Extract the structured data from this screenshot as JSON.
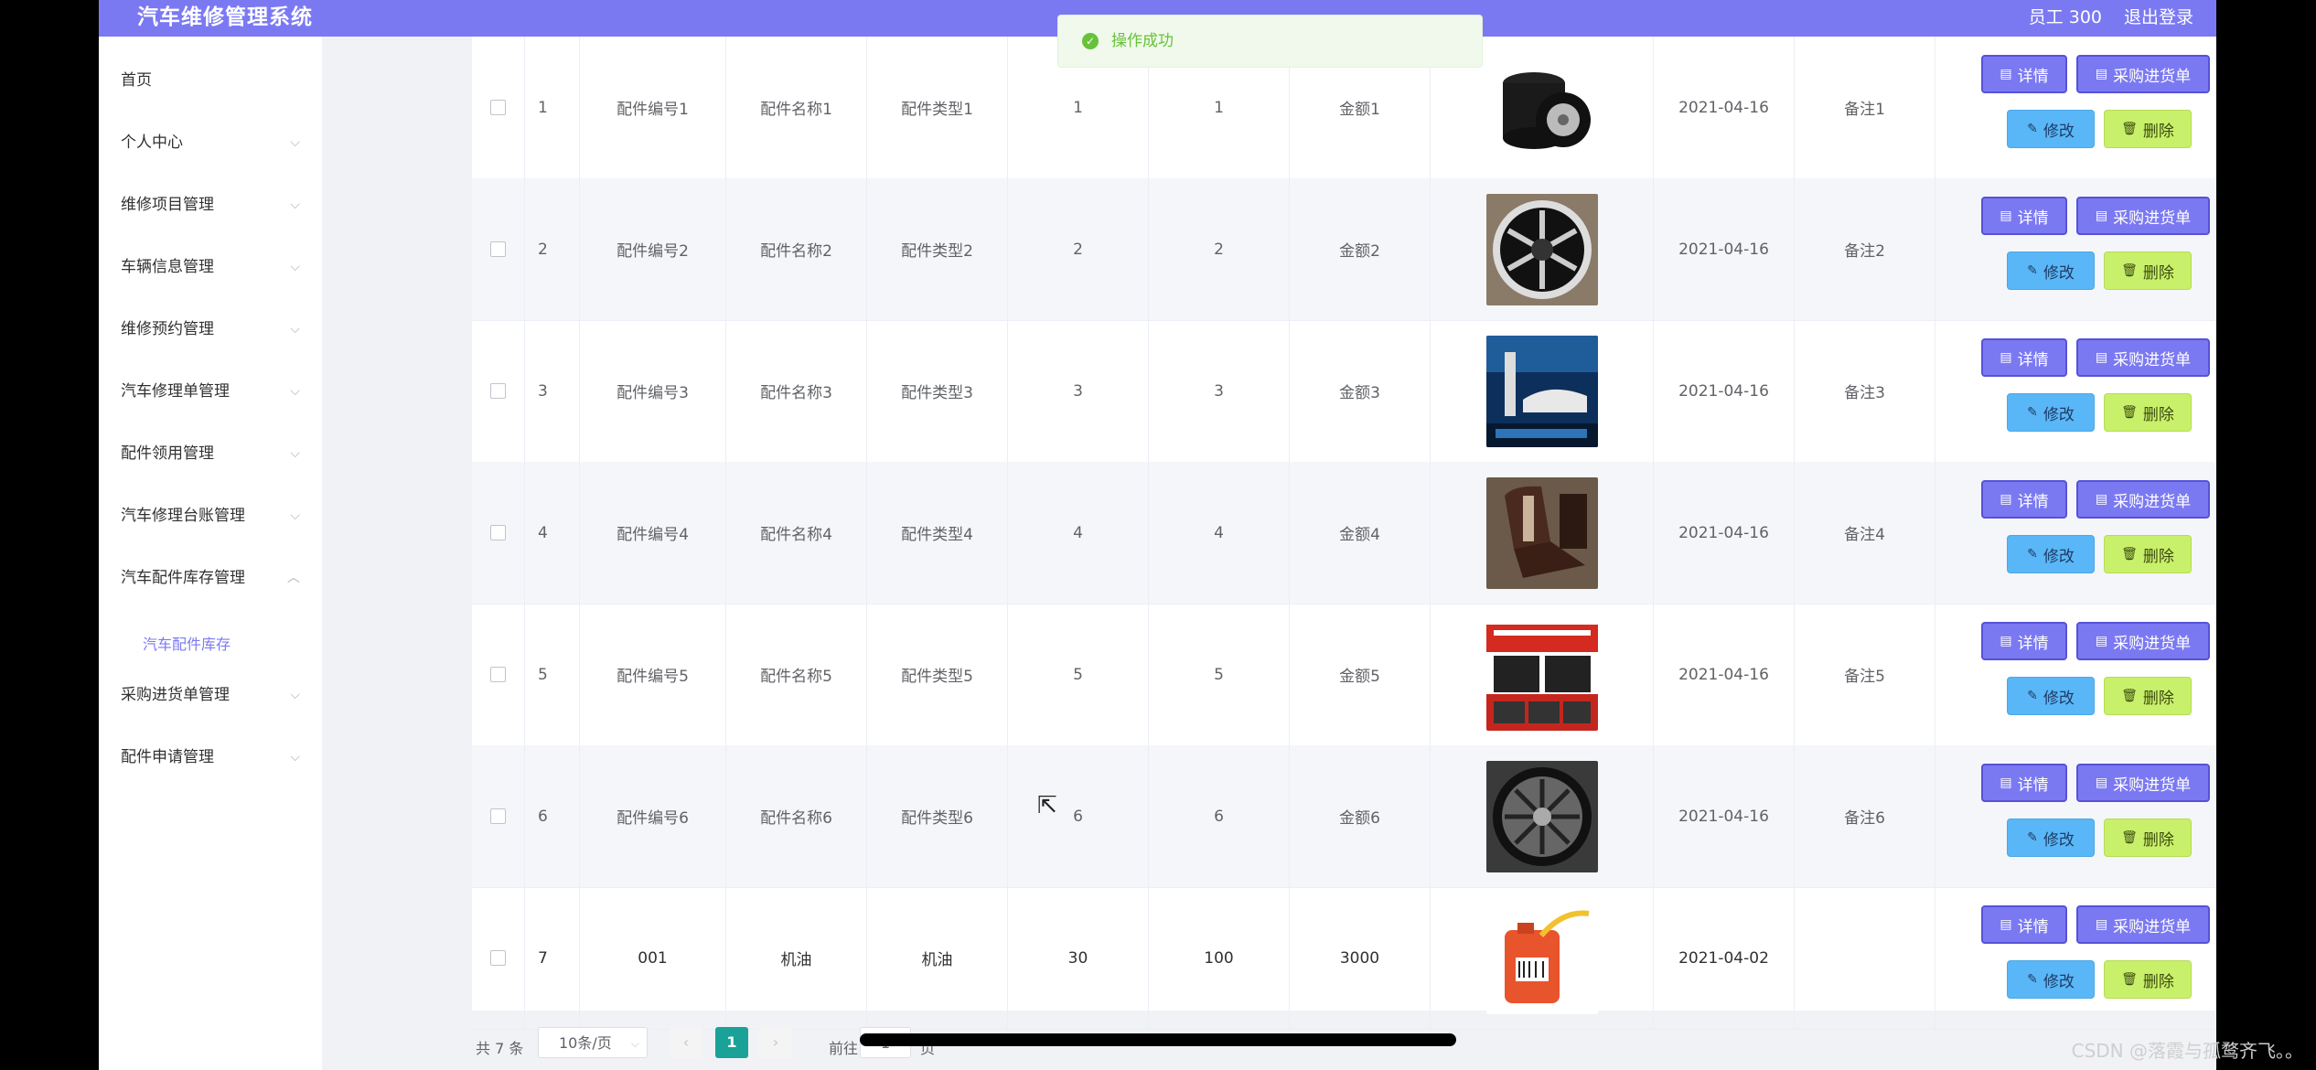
{
  "app": {
    "title": "汽车维修管理系统",
    "user": "员工 300",
    "logout": "退出登录"
  },
  "sidebar": {
    "items": [
      {
        "label": "首页",
        "chevron": ""
      },
      {
        "label": "个人中心",
        "chevron": "⌵"
      },
      {
        "label": "维修项目管理",
        "chevron": "⌵"
      },
      {
        "label": "车辆信息管理",
        "chevron": "⌵"
      },
      {
        "label": "维修预约管理",
        "chevron": "⌵"
      },
      {
        "label": "汽车修理单管理",
        "chevron": "⌵"
      },
      {
        "label": "配件领用管理",
        "chevron": "⌵"
      },
      {
        "label": "汽车修理台账管理",
        "chevron": "⌵"
      },
      {
        "label": "汽车配件库存管理",
        "chevron": "︿"
      },
      {
        "label": "采购进货单管理",
        "chevron": "⌵"
      },
      {
        "label": "配件申请管理",
        "chevron": "⌵"
      }
    ],
    "active_sub": "汽车配件库存"
  },
  "toast": {
    "message": "操作成功"
  },
  "buttons": {
    "detail": "详情",
    "purchase": "采购进货单",
    "edit": "修改",
    "delete": "删除"
  },
  "table": {
    "rows": [
      {
        "index": "1",
        "code": "配件编号1",
        "name": "配件名称1",
        "type": "配件类型1",
        "c1": "1",
        "c2": "1",
        "amount": "金额1",
        "image": "tires",
        "date": "2021-04-16",
        "note": "备注1"
      },
      {
        "index": "2",
        "code": "配件编号2",
        "name": "配件名称2",
        "type": "配件类型2",
        "c1": "2",
        "c2": "2",
        "amount": "金额2",
        "image": "wheel",
        "date": "2021-04-16",
        "note": "备注2"
      },
      {
        "index": "3",
        "code": "配件编号3",
        "name": "配件名称3",
        "type": "配件类型3",
        "c1": "3",
        "c2": "3",
        "amount": "金额3",
        "image": "spark-plug-ad",
        "date": "2021-04-16",
        "note": "备注3"
      },
      {
        "index": "4",
        "code": "配件编号4",
        "name": "配件名称4",
        "type": "配件类型4",
        "c1": "4",
        "c2": "4",
        "amount": "金额4",
        "image": "seat",
        "date": "2021-04-16",
        "note": "备注4"
      },
      {
        "index": "5",
        "code": "配件编号5",
        "name": "配件名称5",
        "type": "配件类型5",
        "c1": "5",
        "c2": "5",
        "amount": "金额5",
        "image": "product-box-ad",
        "date": "2021-04-16",
        "note": "备注5"
      },
      {
        "index": "6",
        "code": "配件编号6",
        "name": "配件名称6",
        "type": "配件类型6",
        "c1": "6",
        "c2": "6",
        "amount": "金额6",
        "image": "rim",
        "date": "2021-04-16",
        "note": "备注6"
      },
      {
        "index": "7",
        "code": "001",
        "name": "机油",
        "type": "机油",
        "c1": "30",
        "c2": "100",
        "amount": "3000",
        "image": "oil-can",
        "date": "2021-04-02",
        "note": ""
      }
    ]
  },
  "pagination": {
    "total": "共 7 条",
    "page_size": "10条/页",
    "current": "1",
    "goto_label": "前往",
    "goto_value": "1",
    "page_suffix": "页"
  },
  "watermark": "CSDN @落霞与孤鹜齐飞。。"
}
